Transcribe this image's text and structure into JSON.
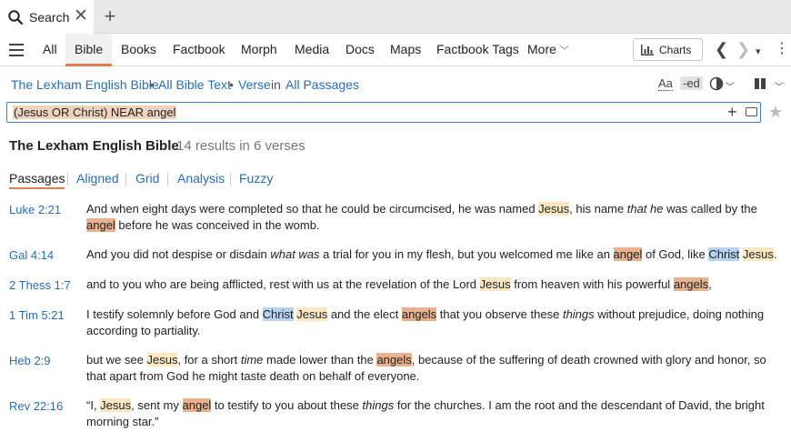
{
  "tabs": {
    "active_label": "Search"
  },
  "nav": {
    "items": [
      "All",
      "Bible",
      "Books",
      "Factbook",
      "Morph",
      "Media",
      "Docs",
      "Maps",
      "Factbook Tags",
      "More"
    ],
    "charts_label": "Charts"
  },
  "breadcrumb": {
    "bible": "The Lexham English Bible",
    "scope": "All Bible Text",
    "unit": "Verse",
    "in_word": "in",
    "passages": "All Passages"
  },
  "tools": {
    "aa": "Aa",
    "ed": "-ed"
  },
  "search": {
    "query": "(Jesus OR Christ) NEAR angel"
  },
  "results": {
    "title": "The Lexham English Bible",
    "count": "14 results in 6 verses"
  },
  "view_tabs": [
    "Passages",
    "Aligned",
    "Grid",
    "Analysis",
    "Fuzzy"
  ],
  "passages": [
    {
      "ref": "Luke 2:21",
      "segments": [
        {
          "t": "And when eight days were completed so that he could be circumcised, he was named "
        },
        {
          "t": "Jesus",
          "h": "j"
        },
        {
          "t": ", his name "
        },
        {
          "t": "that he",
          "i": true
        },
        {
          "t": " was called by the "
        },
        {
          "t": "angel",
          "h": "a"
        },
        {
          "t": " before he was conceived in the womb."
        }
      ]
    },
    {
      "ref": "Gal 4:14",
      "segments": [
        {
          "t": "And you did not despise or disdain "
        },
        {
          "t": "what was",
          "i": true
        },
        {
          "t": " a trial for you in my flesh, but you welcomed me like an "
        },
        {
          "t": "angel",
          "h": "a"
        },
        {
          "t": " of God, like "
        },
        {
          "t": "Christ",
          "h": "c"
        },
        {
          "t": " "
        },
        {
          "t": "Jesus",
          "h": "j"
        },
        {
          "t": "."
        }
      ]
    },
    {
      "ref": "2 Thess 1:7",
      "segments": [
        {
          "t": "and to you who are being afflicted, rest with us at the revelation of the Lord "
        },
        {
          "t": "Jesus",
          "h": "j"
        },
        {
          "t": " from heaven with his powerful "
        },
        {
          "t": "angels",
          "h": "a"
        },
        {
          "t": ","
        }
      ]
    },
    {
      "ref": "1 Tim 5:21",
      "segments": [
        {
          "t": "I testify solemnly before God and "
        },
        {
          "t": "Christ",
          "h": "c"
        },
        {
          "t": " "
        },
        {
          "t": "Jesus",
          "h": "j"
        },
        {
          "t": " and the elect "
        },
        {
          "t": "angels",
          "h": "a"
        },
        {
          "t": " that you observe these "
        },
        {
          "t": "things",
          "i": true
        },
        {
          "t": " without prejudice, doing nothing according to partiality."
        }
      ]
    },
    {
      "ref": "Heb 2:9",
      "segments": [
        {
          "t": "but we see "
        },
        {
          "t": "Jesus",
          "h": "j"
        },
        {
          "t": ", for a short "
        },
        {
          "t": "time",
          "i": true
        },
        {
          "t": " made lower than the "
        },
        {
          "t": "angels",
          "h": "a"
        },
        {
          "t": ", because of the suffering of death crowned with glory and honor, so that apart from God he might taste death on behalf of everyone."
        }
      ]
    },
    {
      "ref": "Rev 22:16",
      "segments": [
        {
          "t": "“I, "
        },
        {
          "t": "Jesus",
          "h": "j"
        },
        {
          "t": ", sent my "
        },
        {
          "t": "angel",
          "h": "a"
        },
        {
          "t": " to testify to you about these "
        },
        {
          "t": "things",
          "i": true
        },
        {
          "t": " for the churches. I am the root and the descendant of David, the bright morning star.”"
        }
      ]
    }
  ],
  "colors": {
    "accent": "#e08050",
    "link": "#2a6db3",
    "hl_jesus": "#fbe8c2",
    "hl_angel": "#e9b28f",
    "hl_christ": "#b7d3f0"
  }
}
